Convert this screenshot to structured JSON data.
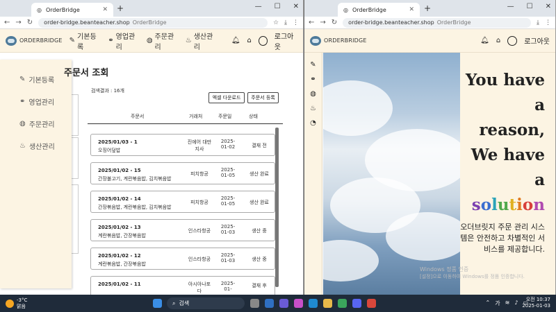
{
  "left": {
    "tab_title": "OrderBridge",
    "url": "order-bridge.beanteacher.shop",
    "url_title": "OrderBridge",
    "brand": "ORDERBRIDGE",
    "menu": [
      "기본등록",
      "영업관리",
      "주문관리",
      "생산관리"
    ],
    "logout": "로그아웃",
    "sidebar": [
      "기본등록",
      "영업관리",
      "주문관리",
      "생산관리"
    ],
    "page_title": "주문서 조회",
    "result_count": "검색결과 : 16개",
    "excel_button": "엑셀 다운로드",
    "register_button": "주문서 등록",
    "columns": [
      "주문서",
      "거래처",
      "주문일",
      "상태"
    ],
    "orders": [
      {
        "id": "2025/01/03 - 1",
        "items": "오징어덮밥",
        "client": "진에어 대만지사",
        "date": "2025-01-02",
        "status": "결재 전"
      },
      {
        "id": "2025/01/02 - 15",
        "items": "간장불고기, 계란볶음밥, 김치볶음밥",
        "client": "피치항공",
        "date": "2025-01-05",
        "status": "생산 완료"
      },
      {
        "id": "2025/01/02 - 14",
        "items": "간장볶음밥, 계란볶음밥, 김치볶음밥",
        "client": "피치항공",
        "date": "2025-01-05",
        "status": "생산 완료"
      },
      {
        "id": "2025/01/02 - 13",
        "items": "계란볶음밥, 간장볶음밥",
        "client": "인스타항공",
        "date": "2025-01-03",
        "status": "생산 중"
      },
      {
        "id": "2025/01/02 - 12",
        "items": "계란볶음밥, 간장볶음밥",
        "client": "인스타항공",
        "date": "2025-01-03",
        "status": "생산 중"
      },
      {
        "id": "2025/01/02 - 11",
        "items": "",
        "client": "아시아나포다",
        "date": "2025-01-",
        "status": "결재 후"
      }
    ]
  },
  "right": {
    "tab_title": "OrderBridge",
    "url": "order-bridge.beanteacher.shop",
    "url_title": "OrderBridge",
    "brand": "ORDERBRIDGE",
    "logout": "로그아웃",
    "headline": [
      "You have",
      "a",
      "reason,",
      "We have a"
    ],
    "solution": "solution",
    "solution_colors": [
      "#7b3fb0",
      "#3b6fd0",
      "#2aa3b8",
      "#4fa84a",
      "#e0b020",
      "#e07a20",
      "#d8403a",
      "#b04ab0"
    ],
    "sub": "오더브릿지 주문 관리 시스템은 안전하고 차별적인 서비스를 제공합니다."
  },
  "watermark": {
    "title": "Windows 정품 인증",
    "body": "[설정]으로 이동하여 Windows를 정품 인증합니다."
  },
  "taskbar": {
    "temp": "-3°C",
    "weather": "맑음",
    "search": "검색",
    "time": "오전 10:37",
    "date": "2025-01-03",
    "lang": "가"
  }
}
